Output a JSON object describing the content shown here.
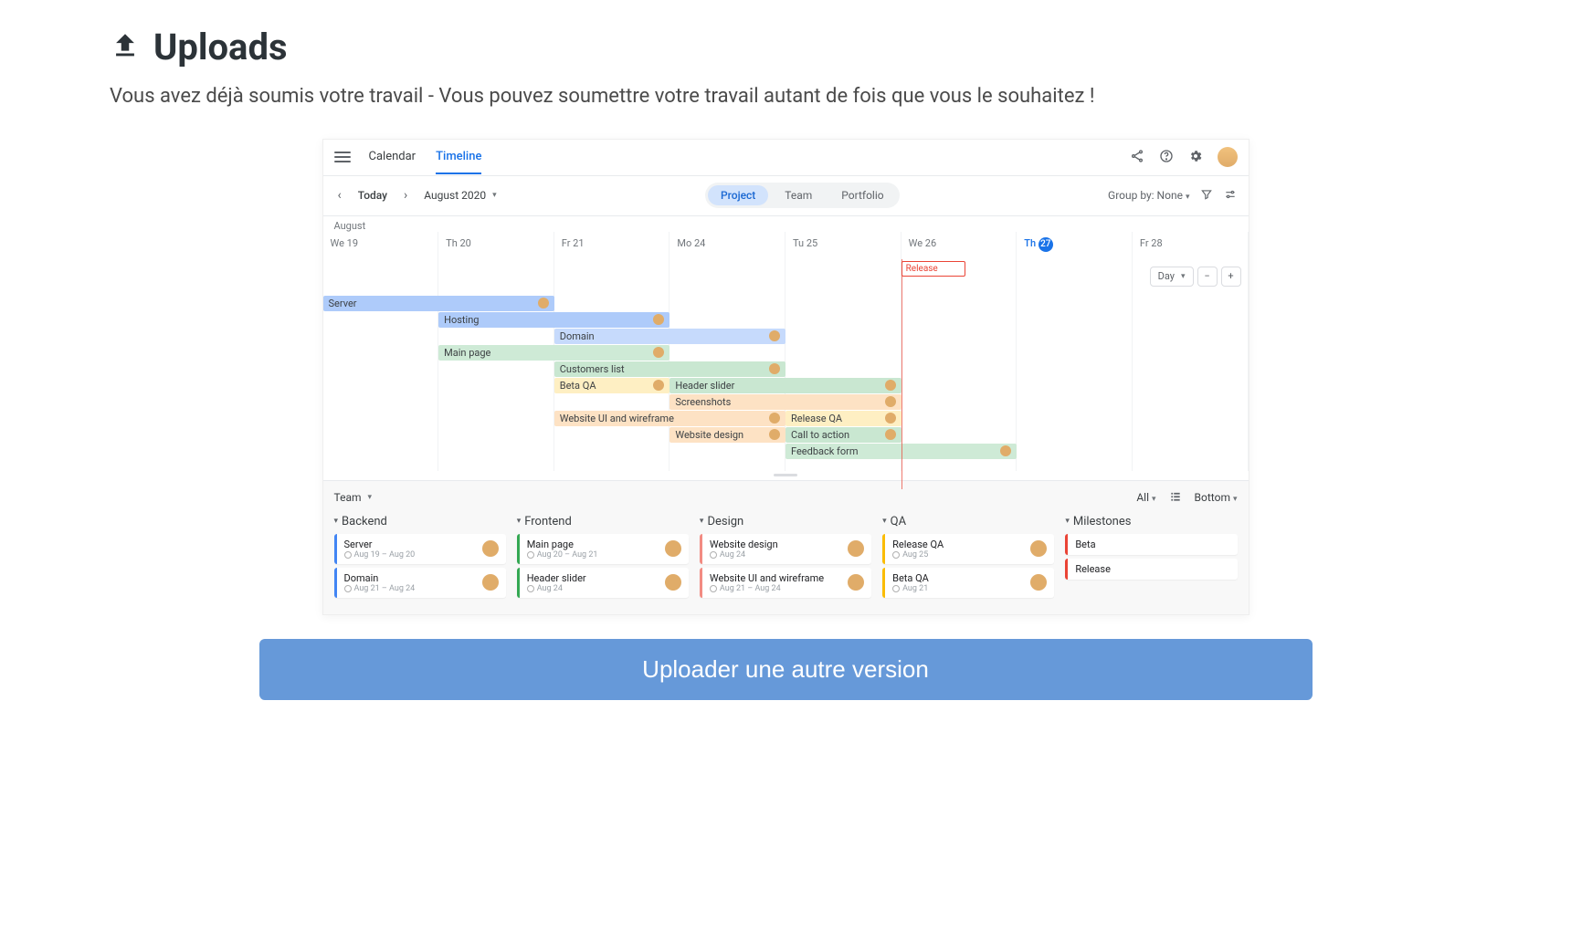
{
  "page": {
    "title": "Uploads",
    "subtitle": "Vous avez déjà soumis votre travail - Vous pouvez soumettre votre travail autant de fois que vous le souhaitez !",
    "upload_button": "Uploader une autre version"
  },
  "app": {
    "tabs": {
      "calendar": "Calendar",
      "timeline": "Timeline"
    },
    "nav": {
      "today": "Today",
      "month": "August 2020"
    },
    "scope": {
      "project": "Project",
      "team": "Team",
      "portfolio": "Portfolio"
    },
    "group_by": "Group by: None",
    "month_label": "August",
    "days": [
      {
        "label": "We",
        "num": "19"
      },
      {
        "label": "Th",
        "num": "20"
      },
      {
        "label": "Fr",
        "num": "21"
      },
      {
        "label": "Mo",
        "num": "24"
      },
      {
        "label": "Tu",
        "num": "25"
      },
      {
        "label": "We",
        "num": "26"
      },
      {
        "label": "Th",
        "num": "27",
        "today": true
      },
      {
        "label": "Fr",
        "num": "28"
      }
    ],
    "zoom": "Day",
    "release_label": "Release",
    "bars": [
      {
        "name": "Server",
        "color": "c-blue",
        "row": 0,
        "start": 0,
        "span": 2
      },
      {
        "name": "Hosting",
        "color": "c-blue",
        "row": 1,
        "start": 1,
        "span": 2
      },
      {
        "name": "Domain",
        "color": "c-blue2",
        "row": 2,
        "start": 2,
        "span": 2
      },
      {
        "name": "Main page",
        "color": "c-green",
        "row": 3,
        "start": 1,
        "span": 2
      },
      {
        "name": "Customers list",
        "color": "c-green2",
        "row": 4,
        "start": 2,
        "span": 2
      },
      {
        "name": "Beta QA",
        "color": "c-yellow",
        "row": 5,
        "start": 2,
        "span": 1
      },
      {
        "name": "Header slider",
        "color": "c-green2",
        "row": 5,
        "start": 3,
        "span": 2
      },
      {
        "name": "Screenshots",
        "color": "c-orange",
        "row": 6,
        "start": 3,
        "span": 2
      },
      {
        "name": "Website UI and wireframe",
        "color": "c-orange",
        "row": 7,
        "start": 2,
        "span": 2
      },
      {
        "name": "Release QA",
        "color": "c-yellow",
        "row": 7,
        "start": 4,
        "span": 1
      },
      {
        "name": "Website design",
        "color": "c-orange",
        "row": 8,
        "start": 3,
        "span": 1
      },
      {
        "name": "Call to action",
        "color": "c-green2",
        "row": 8,
        "start": 4,
        "span": 1
      },
      {
        "name": "Feedback form",
        "color": "c-green",
        "row": 9,
        "start": 4,
        "span": 2
      }
    ],
    "team_panel": {
      "label": "Team",
      "filter_all": "All",
      "position": "Bottom",
      "columns": [
        {
          "title": "Backend",
          "border": "bl-blue",
          "cards": [
            {
              "title": "Server",
              "date": "Aug 19 – Aug 20"
            },
            {
              "title": "Domain",
              "date": "Aug 21 – Aug 24"
            }
          ]
        },
        {
          "title": "Frontend",
          "border": "bl-green",
          "cards": [
            {
              "title": "Main page",
              "date": "Aug 20 – Aug 21"
            },
            {
              "title": "Header slider",
              "date": "Aug 24"
            }
          ]
        },
        {
          "title": "Design",
          "border": "bl-pink",
          "cards": [
            {
              "title": "Website design",
              "date": "Aug 24"
            },
            {
              "title": "Website UI and wireframe",
              "date": "Aug 21 – Aug 24"
            }
          ]
        },
        {
          "title": "QA",
          "border": "bl-yellow",
          "cards": [
            {
              "title": "Release QA",
              "date": "Aug 25"
            },
            {
              "title": "Beta QA",
              "date": "Aug 21"
            }
          ]
        },
        {
          "title": "Milestones",
          "border": "bl-red",
          "cards": [
            {
              "title": "Beta",
              "date": ""
            },
            {
              "title": "Release",
              "date": ""
            }
          ]
        }
      ]
    }
  }
}
